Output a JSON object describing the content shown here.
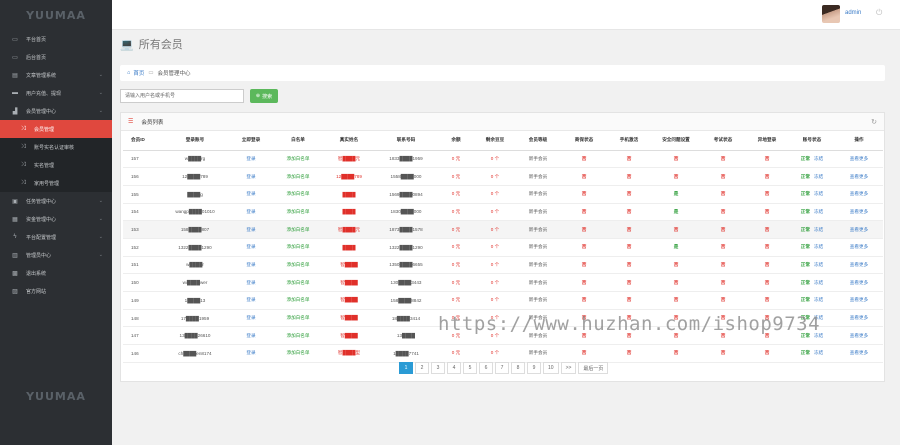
{
  "brand": {
    "top": "YUUMAA",
    "bottom": "YUUMAA"
  },
  "sidebar": {
    "items": [
      {
        "label": "平台首页",
        "icon": "laptop-icon",
        "arrow": false
      },
      {
        "label": "后台首页",
        "icon": "laptop-icon",
        "arrow": false
      },
      {
        "label": "文章管理系统",
        "icon": "file-icon",
        "arrow": true
      },
      {
        "label": "用户充值、提现",
        "icon": "card-icon",
        "arrow": true
      },
      {
        "label": "会员管理中心",
        "icon": "chart-icon",
        "arrow": true
      }
    ],
    "sub_items": [
      {
        "label": "会员管理",
        "active": true
      },
      {
        "label": "账号实名认证审核",
        "active": false
      },
      {
        "label": "实名管理",
        "active": false
      },
      {
        "label": "家用号管理",
        "active": false
      }
    ],
    "items_after": [
      {
        "label": "任务管理中心",
        "icon": "briefcase-icon",
        "arrow": true
      },
      {
        "label": "资金管理中心",
        "icon": "money-icon",
        "arrow": true
      },
      {
        "label": "平台配置管理",
        "icon": "bolt-icon",
        "arrow": true
      },
      {
        "label": "管理员中心",
        "icon": "users-icon",
        "arrow": true
      },
      {
        "label": "退出系统",
        "icon": "calendar-icon",
        "arrow": false
      },
      {
        "label": "官方网站",
        "icon": "image-icon",
        "arrow": false
      }
    ]
  },
  "topbar": {
    "admin_name": "admin"
  },
  "page_title": "所有会员",
  "breadcrumb": {
    "home": "首页",
    "current": "会员管理中心"
  },
  "search": {
    "placeholder": "请输入用户名或手机号",
    "button": "搜索"
  },
  "panel": {
    "title": "会员列表",
    "columns": [
      "会员ID",
      "登录账号",
      "立即登录",
      "白名单",
      "真实姓名",
      "联系号码",
      "余额",
      "剩余豆豆",
      "会员等级",
      "商保状态",
      "手机激活",
      "安全问题设置",
      "考试状态",
      "异地登录",
      "账号状态",
      "操作"
    ],
    "rows": [
      {
        "id": "157",
        "account": "w████rg",
        "login": "登录",
        "white": "添加白名单",
        "name": "智████元",
        "phone": "1833████1959",
        "balance": "0 元",
        "beans": "0 个",
        "level": "新手会员",
        "insure": "否",
        "mobile": "否",
        "safe": "否",
        "exam": "否",
        "remote": "否",
        "status": "正常",
        "freeze": "冻结",
        "op": "查看更多"
      },
      {
        "id": "156",
        "account": "12████789",
        "login": "登录",
        "white": "添加白名单",
        "name": "12████789",
        "phone": "1558████000",
        "balance": "0 元",
        "beans": "0 个",
        "level": "新手会员",
        "insure": "否",
        "mobile": "否",
        "safe": "否",
        "exam": "否",
        "remote": "否",
        "status": "正常",
        "freeze": "冻结",
        "op": "查看更多"
      },
      {
        "id": "155",
        "account": "████g",
        "login": "登录",
        "white": "添加白名单",
        "name": "████",
        "phone": "1569████0894",
        "balance": "0 元",
        "beans": "0 个",
        "level": "新手会员",
        "insure": "否",
        "mobile": "否",
        "safe": "是",
        "exam": "否",
        "remote": "否",
        "status": "正常",
        "freeze": "冻结",
        "op": "查看更多"
      },
      {
        "id": "154",
        "account": "wangp████01010",
        "login": "登录",
        "white": "添加白名单",
        "name": "████",
        "phone": "1830████000",
        "balance": "0 元",
        "beans": "0 个",
        "level": "新手会员",
        "insure": "否",
        "mobile": "否",
        "safe": "是",
        "exam": "否",
        "remote": "否",
        "status": "正常",
        "freeze": "冻结",
        "op": "查看更多"
      },
      {
        "id": "153",
        "account": "158████807",
        "login": "登录",
        "white": "添加白名单",
        "name": "智████元",
        "phone": "1873████1578",
        "balance": "0 元",
        "beans": "0 个",
        "level": "新手会员",
        "insure": "否",
        "mobile": "否",
        "safe": "否",
        "exam": "否",
        "remote": "否",
        "status": "正常",
        "freeze": "冻结",
        "op": "查看更多"
      },
      {
        "id": "152",
        "account": "1322████1290",
        "login": "登录",
        "white": "添加白名单",
        "name": "████",
        "phone": "1322████1290",
        "balance": "0 元",
        "beans": "0 个",
        "level": "新手会员",
        "insure": "否",
        "mobile": "否",
        "safe": "是",
        "exam": "否",
        "remote": "否",
        "status": "正常",
        "freeze": "冻结",
        "op": "查看更多"
      },
      {
        "id": "151",
        "account": "w████r",
        "login": "登录",
        "white": "添加白名单",
        "name": "智████",
        "phone": "1350████6655",
        "balance": "0 元",
        "beans": "0 个",
        "level": "新手会员",
        "insure": "否",
        "mobile": "否",
        "safe": "否",
        "exam": "否",
        "remote": "否",
        "status": "正常",
        "freeze": "冻结",
        "op": "查看更多"
      },
      {
        "id": "150",
        "account": "wi████wer",
        "login": "登录",
        "white": "添加白名单",
        "name": "智████",
        "phone": "130████3443",
        "balance": "0 元",
        "beans": "0 个",
        "level": "新手会员",
        "insure": "否",
        "mobile": "否",
        "safe": "否",
        "exam": "否",
        "remote": "否",
        "status": "正常",
        "freeze": "冻结",
        "op": "查看更多"
      },
      {
        "id": "149",
        "account": "1████13",
        "login": "登录",
        "white": "添加白名单",
        "name": "智████",
        "phone": "158████8842",
        "balance": "0 元",
        "beans": "0 个",
        "level": "新手会员",
        "insure": "否",
        "mobile": "否",
        "safe": "否",
        "exam": "否",
        "remote": "否",
        "status": "正常",
        "freeze": "冻结",
        "op": "查看更多"
      },
      {
        "id": "148",
        "account": "17████1959",
        "login": "登录",
        "white": "添加白名单",
        "name": "智████",
        "phone": "18████3414",
        "balance": "0 元",
        "beans": "0 个",
        "level": "新手会员",
        "insure": "否",
        "mobile": "否",
        "safe": "否",
        "exam": "否",
        "remote": "否",
        "status": "正常",
        "freeze": "冻结",
        "op": "查看更多"
      },
      {
        "id": "147",
        "account": "13████26610",
        "login": "登录",
        "white": "添加白名单",
        "name": "智████",
        "phone": "13████",
        "balance": "0 元",
        "beans": "0 个",
        "level": "新手会员",
        "insure": "否",
        "mobile": "否",
        "safe": "否",
        "exam": "否",
        "remote": "否",
        "status": "正常",
        "freeze": "冻结",
        "op": "查看更多"
      },
      {
        "id": "146",
        "account": "ch████en8174",
        "login": "登录",
        "white": "添加白名单",
        "name": "智████型",
        "phone": "1████7741",
        "balance": "0 元",
        "beans": "0 个",
        "level": "新手会员",
        "insure": "否",
        "mobile": "否",
        "safe": "否",
        "exam": "否",
        "remote": "否",
        "status": "正常",
        "freeze": "冻结",
        "op": "查看更多"
      }
    ]
  },
  "pagination": {
    "pages": [
      "1",
      "2",
      "3",
      "4",
      "5",
      "6",
      "7",
      "8",
      "9",
      "10",
      ">>",
      "最后一页"
    ],
    "active": "1"
  },
  "watermark": "https://www.huzhan.com/ishop9734"
}
